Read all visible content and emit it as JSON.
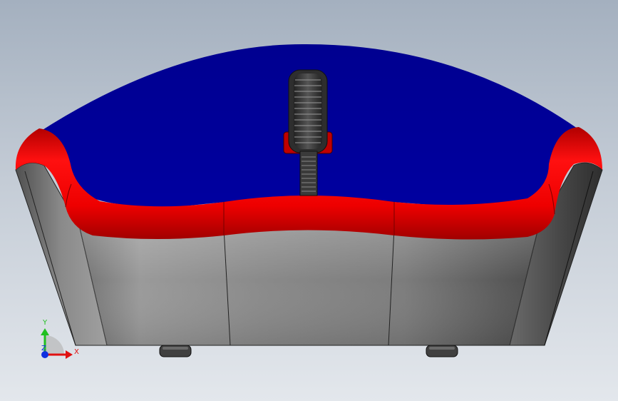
{
  "viewport": {
    "background_top": "#a4b0bf",
    "background_bottom": "#e3e7ec"
  },
  "model": {
    "top_shell_color": "#00008c",
    "band_color": "#e00000",
    "body_color": "#808080",
    "wheel_color": "#3a3a3a",
    "feet_color": "#404040"
  },
  "triad": {
    "x_label": "X",
    "y_label": "Y",
    "z_label": "Z",
    "x_color": "#e01010",
    "y_color": "#20c020",
    "z_color": "#1030e0"
  }
}
